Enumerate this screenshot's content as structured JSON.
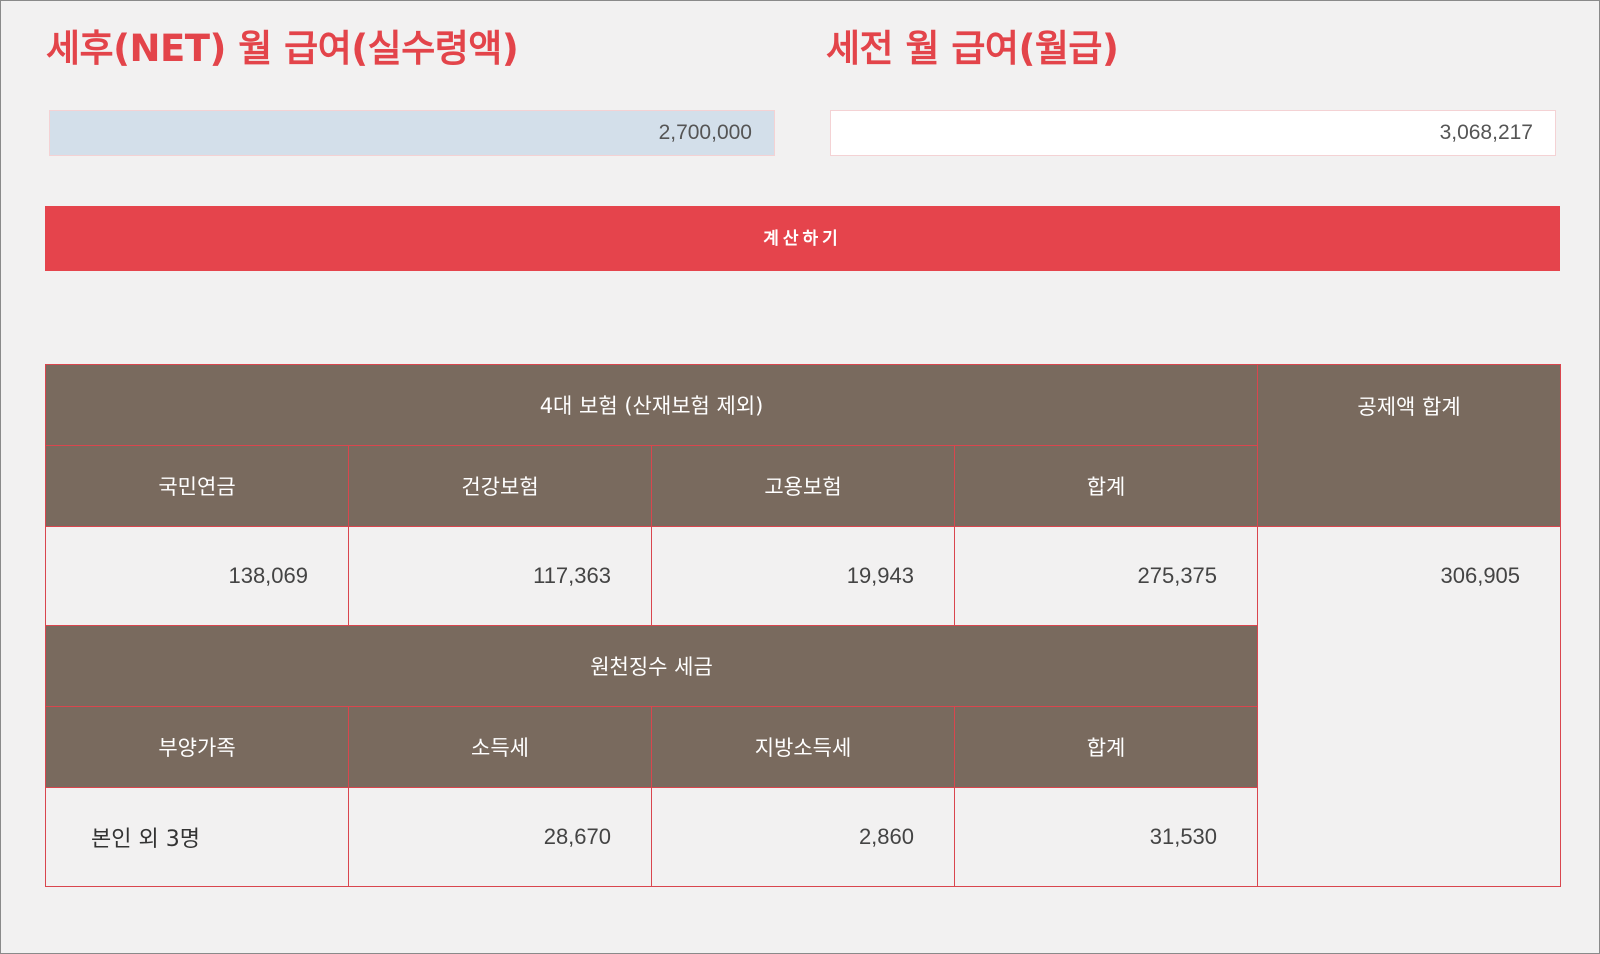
{
  "headings": {
    "net": "세후(NET) 월 급여(실수령액)",
    "gross": "세전 월 급여(월급)"
  },
  "inputs": {
    "net_value": "2,700,000",
    "gross_value": "3,068,217"
  },
  "button": {
    "calculate": "계산하기"
  },
  "table": {
    "insurance_header": "4대 보험 (산재보험 제외)",
    "deduction_total_header": "공제액 합계",
    "insurance_columns": [
      "국민연금",
      "건강보험",
      "고용보험",
      "합계"
    ],
    "insurance_values": [
      "138,069",
      "117,363",
      "19,943",
      "275,375"
    ],
    "deduction_total_value": "306,905",
    "tax_header": "원천징수 세금",
    "tax_columns": [
      "부양가족",
      "소득세",
      "지방소득세",
      "합계"
    ],
    "tax_values": [
      "본인 외 3명",
      "28,670",
      "2,860",
      "31,530"
    ]
  },
  "colors": {
    "accent": "#e3444a",
    "table_header": "#796a5e",
    "net_field_bg": "#d3dfea"
  }
}
